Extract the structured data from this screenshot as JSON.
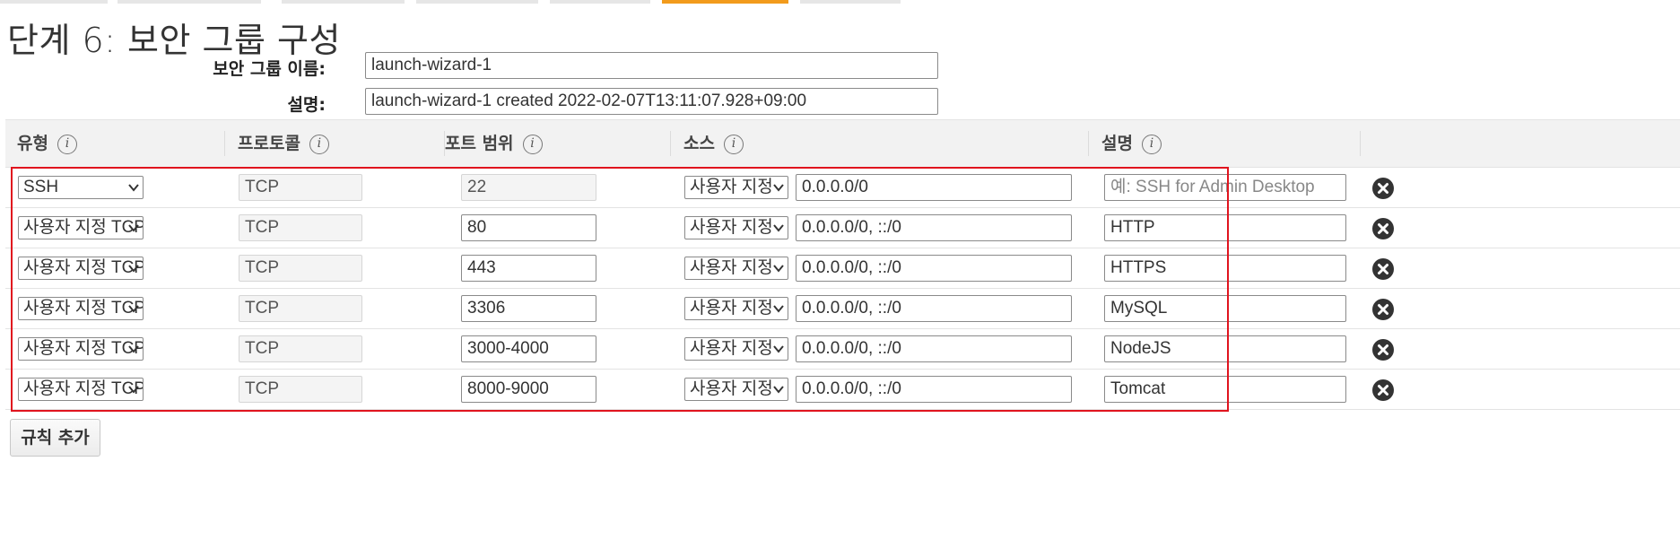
{
  "title": "단계 6: 보안 그룹 구성",
  "form": {
    "group_name_label": "보안 그룹 이름:",
    "group_name_value": "launch-wizard-1",
    "description_label": "설명:",
    "description_value": "launch-wizard-1 created 2022-02-07T13:11:07.928+09:00"
  },
  "table": {
    "headers": {
      "type": "유형",
      "protocol": "프로토콜",
      "port_range": "포트 범위",
      "source": "소스",
      "description": "설명"
    },
    "rows": [
      {
        "type": "SSH",
        "protocol": "TCP",
        "port": "22",
        "source_type": "사용자 지정",
        "source": "0.0.0.0/0",
        "description": "",
        "description_placeholder": "예: SSH for Admin Desktop"
      },
      {
        "type": "사용자 지정 TCP",
        "protocol": "TCP",
        "port": "80",
        "source_type": "사용자 지정",
        "source": "0.0.0.0/0, ::/0",
        "description": "HTTP",
        "description_placeholder": ""
      },
      {
        "type": "사용자 지정 TCP",
        "protocol": "TCP",
        "port": "443",
        "source_type": "사용자 지정",
        "source": "0.0.0.0/0, ::/0",
        "description": "HTTPS",
        "description_placeholder": ""
      },
      {
        "type": "사용자 지정 TCP",
        "protocol": "TCP",
        "port": "3306",
        "source_type": "사용자 지정",
        "source": "0.0.0.0/0, ::/0",
        "description": "MySQL",
        "description_placeholder": ""
      },
      {
        "type": "사용자 지정 TCP",
        "protocol": "TCP",
        "port": "3000-4000",
        "source_type": "사용자 지정",
        "source": "0.0.0.0/0, ::/0",
        "description": "NodeJS",
        "description_placeholder": ""
      },
      {
        "type": "사용자 지정 TCP",
        "protocol": "TCP",
        "port": "8000-9000",
        "source_type": "사용자 지정",
        "source": "0.0.0.0/0, ::/0",
        "description": "Tomcat",
        "description_placeholder": ""
      }
    ]
  },
  "add_rule_label": "규칙 추가",
  "icons": {
    "info": "info-icon",
    "remove": "remove-rule-icon",
    "chevron": "chevron-down-icon"
  },
  "colors": {
    "active_tab": "#f29b1c",
    "highlight_box": "#e0141e",
    "header_bg": "#f2f2f2"
  }
}
